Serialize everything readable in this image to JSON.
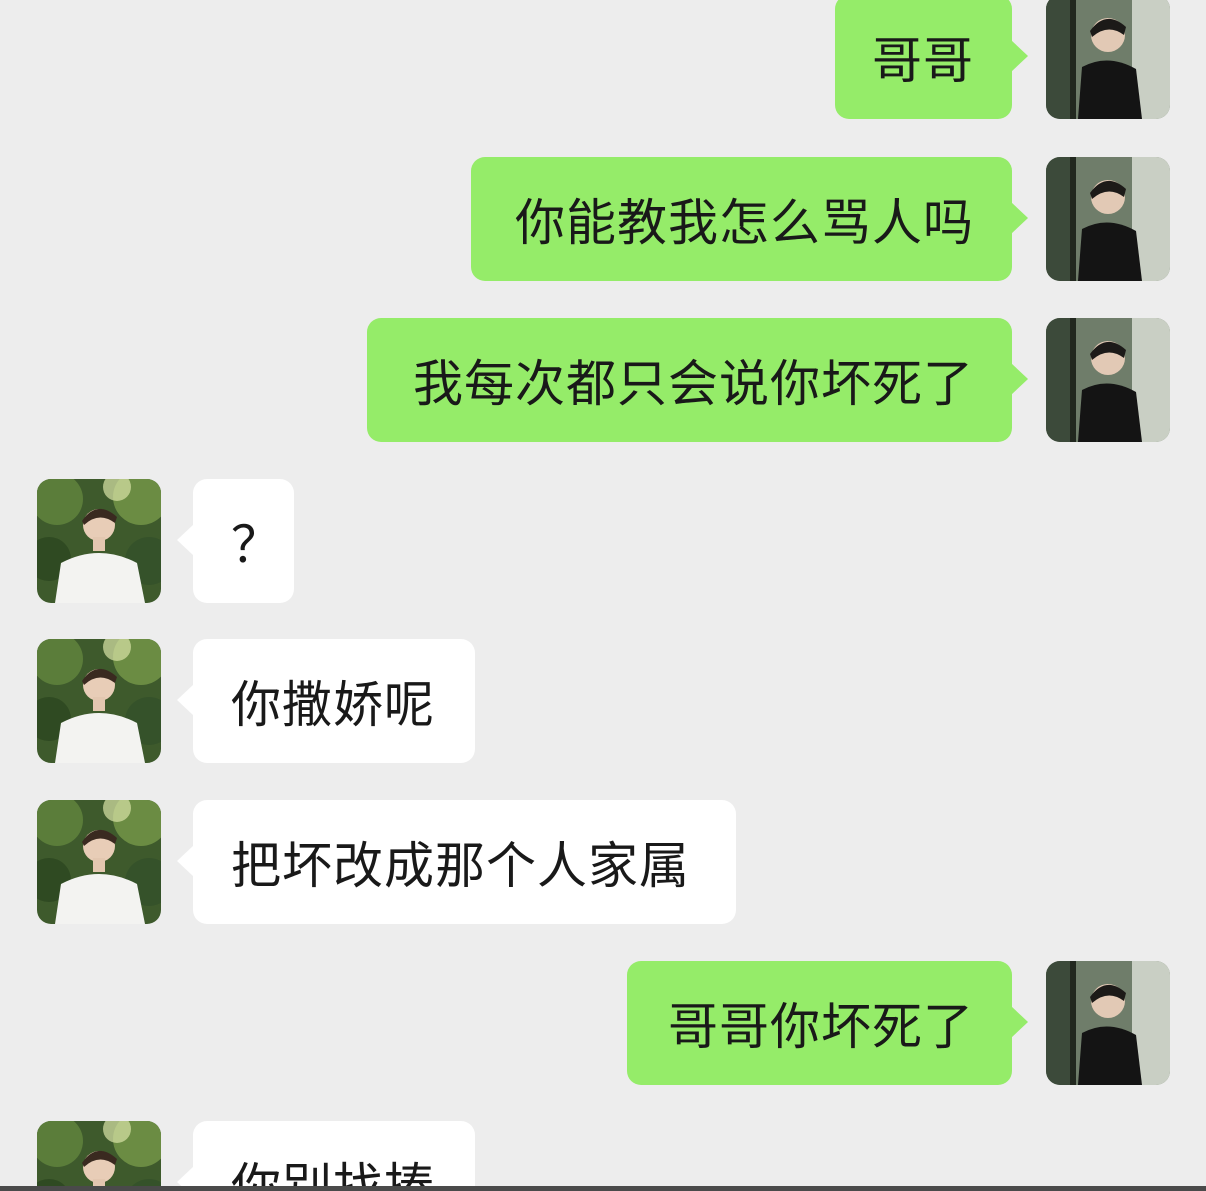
{
  "messages": [
    {
      "side": "out",
      "text": "哥哥",
      "avatar": "self-avatar"
    },
    {
      "side": "out",
      "text": "你能教我怎么骂人吗",
      "avatar": "self-avatar"
    },
    {
      "side": "out",
      "text": "我每次都只会说你坏死了",
      "avatar": "self-avatar"
    },
    {
      "side": "in",
      "text": "？",
      "avatar": "contact-avatar"
    },
    {
      "side": "in",
      "text": "你撒娇呢",
      "avatar": "contact-avatar"
    },
    {
      "side": "in",
      "text": "把坏改成那个人家属",
      "avatar": "contact-avatar"
    },
    {
      "side": "out",
      "text": "哥哥你坏死了",
      "avatar": "self-avatar"
    },
    {
      "side": "in",
      "text": "你别找揍",
      "avatar": "contact-avatar"
    }
  ],
  "colors": {
    "background": "#ededed",
    "outgoing_bubble": "#95ec69",
    "incoming_bubble": "#ffffff",
    "text": "#191919"
  }
}
